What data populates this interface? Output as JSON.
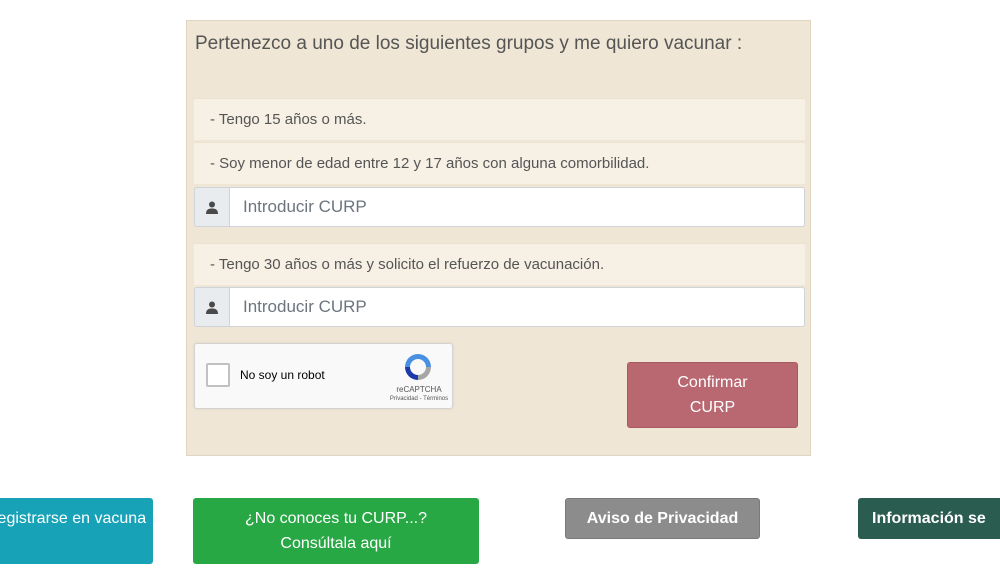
{
  "panel": {
    "title": "Pertenezco a uno de los siguientes grupos y me quiero vacunar :",
    "options": [
      {
        "label": "- Tengo 15 años o más."
      },
      {
        "label": "- Soy menor de edad entre 12 y 17 años con alguna comorbilidad."
      },
      {
        "label": "- Tengo 30 años o más y solicito el refuerzo de vacunación."
      }
    ],
    "curp_inputs": [
      {
        "placeholder": "Introducir CURP",
        "value": ""
      },
      {
        "placeholder": "Introducir CURP",
        "value": ""
      }
    ],
    "icons": {
      "input_addon": "user-icon"
    }
  },
  "recaptcha": {
    "label": "No soy un robot",
    "brand": "reCAPTCHA",
    "links": "Privacidad - Términos",
    "checked": false
  },
  "confirm_button": {
    "label": "Confirmar CURP"
  },
  "bottom_buttons": {
    "register": "Registrarse en vacuna",
    "register_visible": "egistrarse en acuna",
    "find_curp": "¿No conoces tu CURP...? Consúltala aquí",
    "privacy": "Aviso de Privacidad",
    "info": "Información se"
  },
  "colors": {
    "panel_bg": "#efe6d5",
    "confirm": "#b96872",
    "register": "#17a2b8",
    "find_curp": "#28a745",
    "privacy": "#8c8c8c",
    "info": "#2a5c4f"
  }
}
